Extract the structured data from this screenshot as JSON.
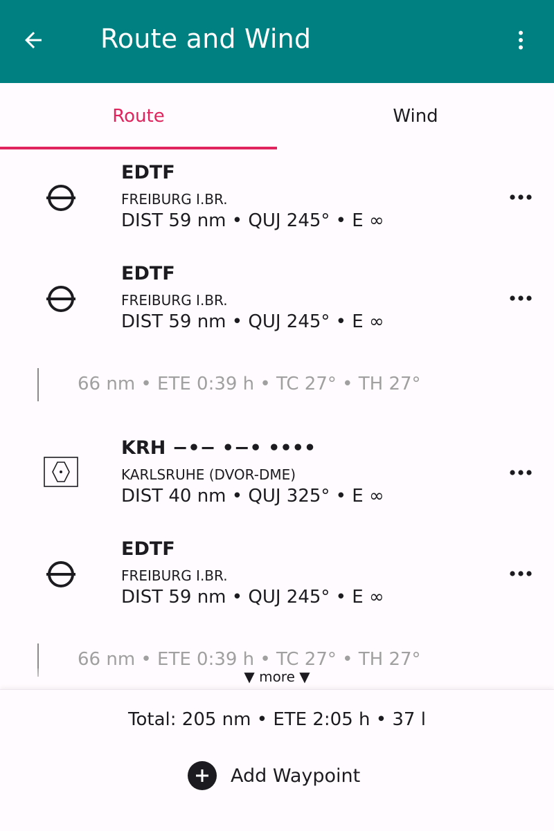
{
  "appbar": {
    "title": "Route and Wind",
    "back_icon": "arrow-back-icon",
    "menu_icon": "more-vert-icon",
    "background": "#008080"
  },
  "tabs": [
    {
      "label": "Route",
      "selected": true,
      "color": "#e0245e"
    },
    {
      "label": "Wind",
      "selected": false
    }
  ],
  "waypoints": [
    {
      "code": "EDTF",
      "name": "FREIBURG I.BR.",
      "info": "DIST 59 nm • QUJ 245° • E ∞",
      "icon": "airfield-icon"
    },
    {
      "code": "EDTF",
      "name": "FREIBURG I.BR.",
      "info": "DIST 59 nm • QUJ 245° • E ∞",
      "icon": "airfield-icon"
    },
    {
      "code": "KRH −•− •−• ••••",
      "name": "KARLSRUHE (DVOR-DME)",
      "info": "DIST 40 nm • QUJ 325° • E ∞",
      "icon": "vor-dme-icon"
    },
    {
      "code": "EDTF",
      "name": "FREIBURG I.BR.",
      "info": "DIST 59 nm • QUJ 245° • E ∞",
      "icon": "airfield-icon"
    }
  ],
  "legs": [
    {
      "text": "66 nm • ETE 0:39 h • TC 27° • TH 27°"
    },
    {
      "text": "66 nm • ETE 0:39 h • TC 27° • TH 27°"
    }
  ],
  "more_label": "▼ more ▼",
  "footer": {
    "total": "Total: 205 nm • ETE 2:05 h • 37 l",
    "add_label": "Add Waypoint",
    "add_icon": "add-circle-icon"
  }
}
